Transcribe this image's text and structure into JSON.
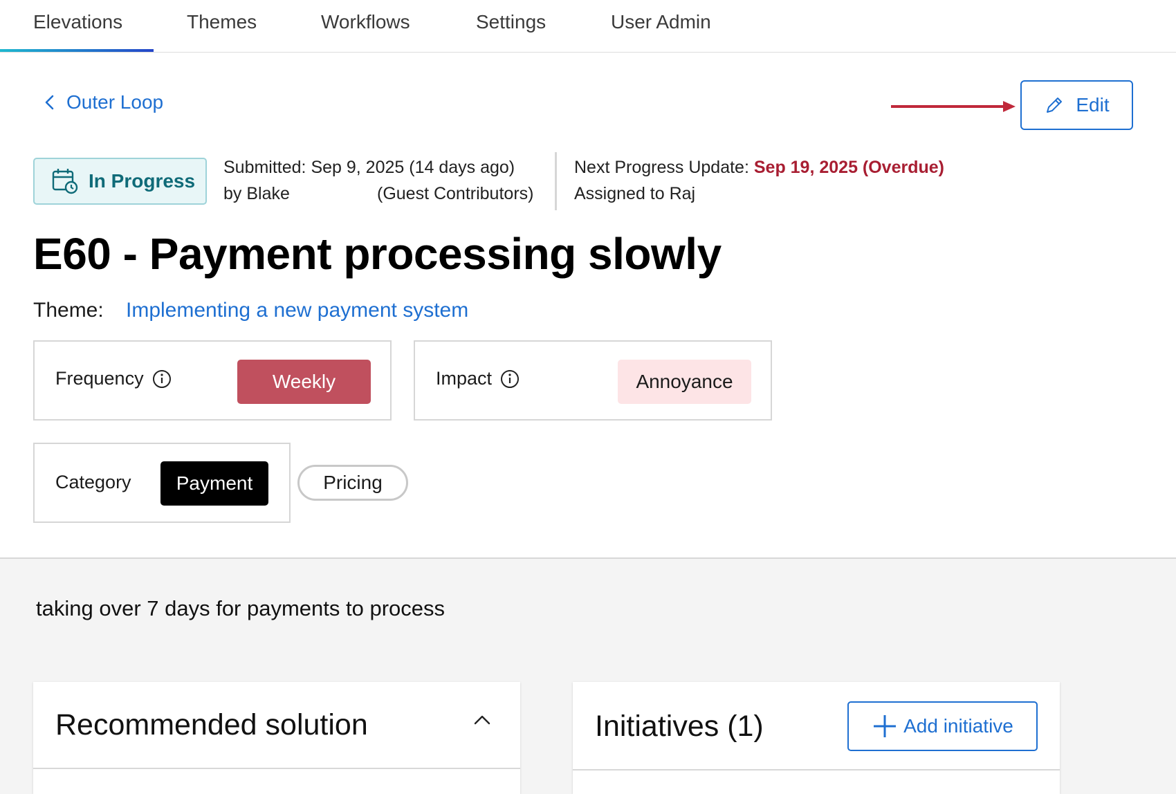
{
  "nav": {
    "tabs": [
      {
        "label": "Elevations",
        "active": true
      },
      {
        "label": "Themes"
      },
      {
        "label": "Workflows"
      },
      {
        "label": "Settings"
      },
      {
        "label": "User Admin"
      }
    ]
  },
  "header": {
    "back_label": "Outer Loop",
    "edit_label": "Edit"
  },
  "status": {
    "label": "In Progress",
    "submitted_line": "Submitted: Sep 9, 2025 (14 days ago)",
    "submitted_by": "by Blake",
    "submitted_group": "(Guest Contributors)",
    "next_update_label": "Next Progress Update:",
    "next_update_value": "Sep 19, 2025 (Overdue)",
    "assigned": "Assigned to Raj"
  },
  "elevation": {
    "title": "E60 - Payment processing slowly",
    "theme_label": "Theme:",
    "theme_value": "Implementing a new payment system"
  },
  "fields": {
    "frequency_label": "Frequency",
    "frequency_value": "Weekly",
    "impact_label": "Impact",
    "impact_value": "Annoyance",
    "category_label": "Category",
    "category_selected": "Payment",
    "category_other": "Pricing"
  },
  "body": {
    "description": "taking over 7 days for payments to process",
    "solution_title": "Recommended solution",
    "initiatives_title": "Initiatives (1)",
    "add_initiative_label": "Add initiative"
  },
  "colors": {
    "accent": "#1e6fd1",
    "overdue": "#a81e32",
    "weekly_pill": "#c0505e",
    "annoyance_pill": "#fde4e6",
    "status_bg": "#e8f6f7",
    "status_text": "#0f6b78",
    "annotation_arrow": "#c0283a"
  }
}
